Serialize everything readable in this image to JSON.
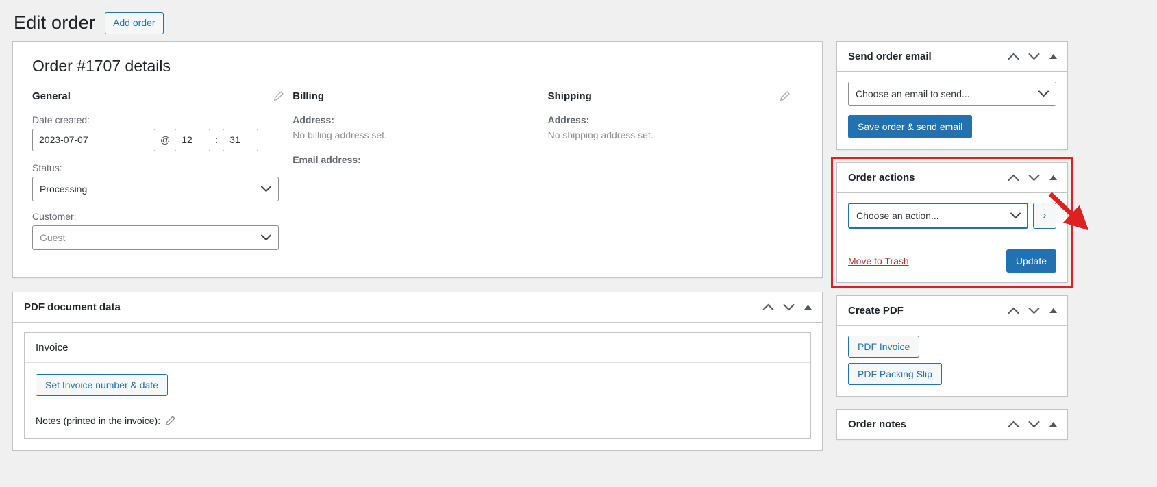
{
  "header": {
    "title": "Edit order",
    "add_order_label": "Add order"
  },
  "order": {
    "details_title": "Order #1707 details",
    "general": {
      "heading": "General",
      "date_created_label": "Date created:",
      "date_value": "2023-07-07",
      "at_symbol": "@",
      "hour_value": "12",
      "time_separator": ":",
      "minute_value": "31",
      "status_label": "Status:",
      "status_value": "Processing",
      "customer_label": "Customer:",
      "customer_value": "Guest"
    },
    "billing": {
      "heading": "Billing",
      "address_label": "Address:",
      "address_value": "No billing address set.",
      "email_label": "Email address:"
    },
    "shipping": {
      "heading": "Shipping",
      "address_label": "Address:",
      "address_value": "No shipping address set."
    }
  },
  "pdf_document_data": {
    "title": "PDF document data",
    "invoice_label": "Invoice",
    "set_invoice_button": "Set Invoice number & date",
    "notes_label": "Notes (printed in the invoice):"
  },
  "sidebar": {
    "send_order_email": {
      "title": "Send order email",
      "select_value": "Choose an email to send...",
      "save_button": "Save order & send email"
    },
    "order_actions": {
      "title": "Order actions",
      "select_value": "Choose an action...",
      "go_button": "›",
      "trash_link": "Move to Trash",
      "update_button": "Update"
    },
    "create_pdf": {
      "title": "Create PDF",
      "buttons": [
        "PDF Invoice",
        "PDF Packing Slip"
      ]
    },
    "order_notes": {
      "title": "Order notes"
    }
  },
  "colors": {
    "accent": "#2271b1",
    "highlight": "#e02020",
    "danger": "#b32d2e"
  }
}
